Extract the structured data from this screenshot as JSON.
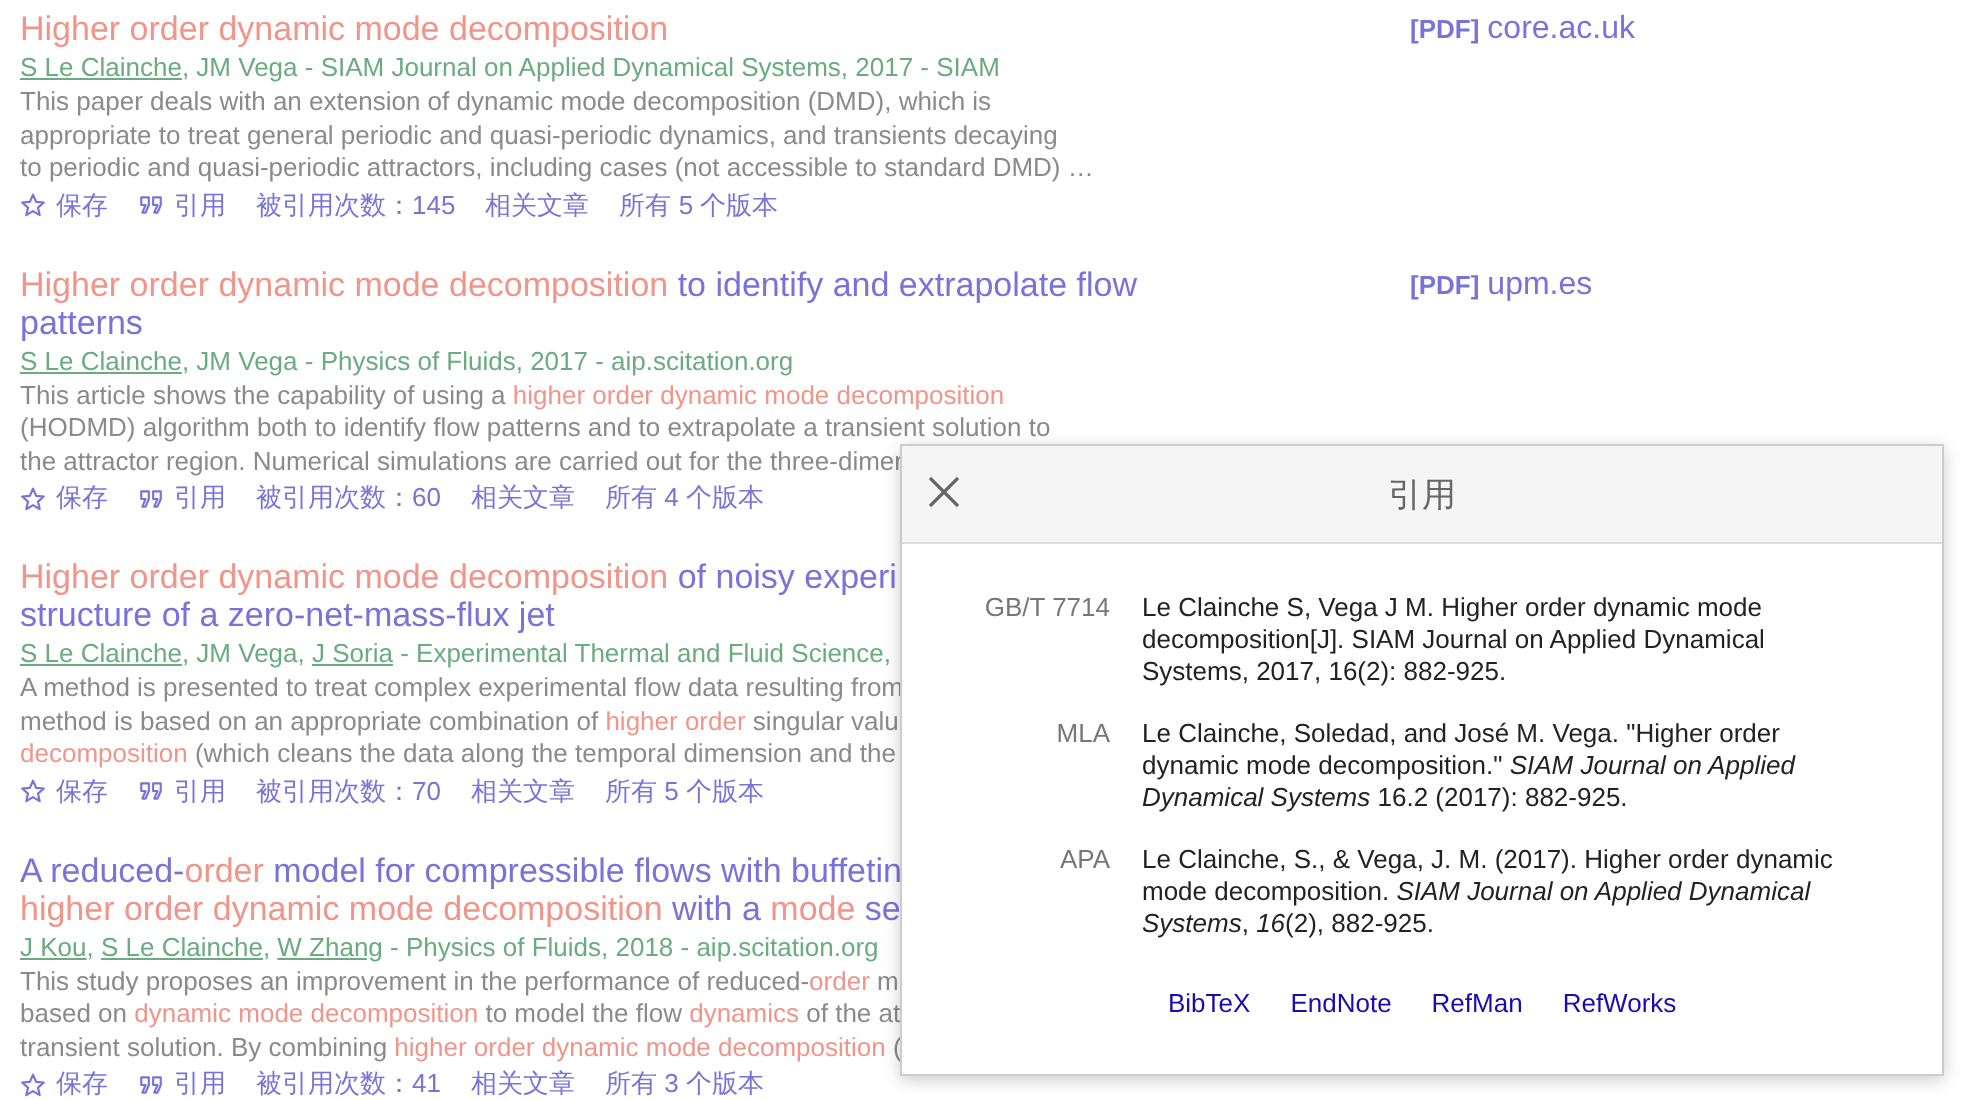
{
  "results": [
    {
      "title": [
        [
          {
            "text": "Higher order dynamic mode decomposition",
            "hl": true
          }
        ]
      ],
      "authors": [
        {
          "text": "S Le Clainche",
          "link": true
        },
        {
          "text": ", JM Vega - SIAM Journal on Applied Dynamical Systems, 2017 - SIAM",
          "link": false
        }
      ],
      "snippet": [
        [
          {
            "text": "This paper deals with an extension of dynamic mode decomposition (DMD), which is",
            "hl": false
          }
        ],
        [
          {
            "text": "appropriate to treat general periodic and quasi-periodic dynamics, and transients decaying",
            "hl": false
          }
        ],
        [
          {
            "text": "to periodic and quasi-periodic attractors, including cases (not accessible to standard DMD) …",
            "hl": false
          }
        ]
      ],
      "actions": [
        {
          "kind": "save",
          "label": "保存"
        },
        {
          "kind": "cite",
          "label": "引用"
        },
        {
          "kind": "text",
          "label": "被引用次数：145"
        },
        {
          "kind": "text",
          "label": "相关文章"
        },
        {
          "kind": "text",
          "label": "所有 5 个版本"
        }
      ],
      "source": {
        "tag": "[PDF]",
        "domain": "core.ac.uk"
      }
    },
    {
      "title": [
        [
          {
            "text": "Higher order dynamic mode decomposition",
            "hl": true
          },
          {
            "text": " to identify and extrapolate flow",
            "hl": false
          }
        ],
        [
          {
            "text": "patterns",
            "hl": false
          }
        ]
      ],
      "authors": [
        {
          "text": "S Le Clainche",
          "link": true
        },
        {
          "text": ", JM Vega - Physics of Fluids, 2017 - aip.scitation.org",
          "link": false
        }
      ],
      "snippet": [
        [
          {
            "text": "This article shows the capability of using a ",
            "hl": false
          },
          {
            "text": "higher order dynamic mode decomposition",
            "hl": true
          }
        ],
        [
          {
            "text": "(HODMD) algorithm both to identify flow patterns and to extrapolate a transient solution to",
            "hl": false
          }
        ],
        [
          {
            "text": "the attractor region. Numerical simulations are carried out for the three-dimer",
            "hl": false
          }
        ]
      ],
      "actions": [
        {
          "kind": "save",
          "label": "保存"
        },
        {
          "kind": "cite",
          "label": "引用"
        },
        {
          "kind": "text",
          "label": "被引用次数：60"
        },
        {
          "kind": "text",
          "label": "相关文章"
        },
        {
          "kind": "text",
          "label": "所有 4 个版本"
        }
      ],
      "source": {
        "tag": "[PDF]",
        "domain": "upm.es"
      }
    },
    {
      "title": [
        [
          {
            "text": "Higher order dynamic mode decomposition",
            "hl": true
          },
          {
            "text": " of noisy experi",
            "hl": false
          }
        ],
        [
          {
            "text": "structure of a zero-net-mass-flux jet",
            "hl": false
          }
        ]
      ],
      "authors": [
        {
          "text": "S Le Clainche",
          "link": true
        },
        {
          "text": ", JM Vega, ",
          "link": false
        },
        {
          "text": "J Soria",
          "link": true
        },
        {
          "text": " - Experimental Thermal and Fluid Science,",
          "link": false
        }
      ],
      "snippet": [
        [
          {
            "text": "A method is presented to treat complex experimental flow data resulting from",
            "hl": false
          }
        ],
        [
          {
            "text": "method is based on an appropriate combination of ",
            "hl": false
          },
          {
            "text": "higher order",
            "hl": true
          },
          {
            "text": " singular valu",
            "hl": false
          }
        ],
        [
          {
            "text": "decomposition",
            "hl": true
          },
          {
            "text": " (which cleans the data along the temporal dimension and the",
            "hl": false
          }
        ]
      ],
      "actions": [
        {
          "kind": "save",
          "label": "保存"
        },
        {
          "kind": "cite",
          "label": "引用"
        },
        {
          "kind": "text",
          "label": "被引用次数：70"
        },
        {
          "kind": "text",
          "label": "相关文章"
        },
        {
          "kind": "text",
          "label": "所有 5 个版本"
        }
      ]
    },
    {
      "title": [
        [
          {
            "text": "A reduced-",
            "hl": false
          },
          {
            "text": "order",
            "hl": true
          },
          {
            "text": " model for compressible flows with buffetin",
            "hl": false
          }
        ],
        [
          {
            "text": "higher order dynamic mode decomposition",
            "hl": true
          },
          {
            "text": " with a ",
            "hl": false
          },
          {
            "text": "mode",
            "hl": true
          },
          {
            "text": " se",
            "hl": false
          }
        ]
      ],
      "authors": [
        {
          "text": "J Kou",
          "link": true
        },
        {
          "text": ", ",
          "link": false
        },
        {
          "text": "S Le Clainche",
          "link": true
        },
        {
          "text": ", ",
          "link": false
        },
        {
          "text": "W Zhang",
          "link": true
        },
        {
          "text": " - Physics of Fluids, 2018 - aip.scitation.org",
          "link": false
        }
      ],
      "snippet": [
        [
          {
            "text": "This study proposes an improvement in the performance of reduced-",
            "hl": false
          },
          {
            "text": "order",
            "hl": true
          },
          {
            "text": " m",
            "hl": false
          }
        ],
        [
          {
            "text": "based on ",
            "hl": false
          },
          {
            "text": "dynamic mode decomposition",
            "hl": true
          },
          {
            "text": " to model the flow ",
            "hl": false
          },
          {
            "text": "dynamics",
            "hl": true
          },
          {
            "text": " of the at",
            "hl": false
          }
        ],
        [
          {
            "text": "transient solution. By combining ",
            "hl": false
          },
          {
            "text": "higher order dynamic mode decomposition",
            "hl": true
          },
          {
            "text": " (",
            "hl": false
          }
        ]
      ],
      "actions": [
        {
          "kind": "save",
          "label": "保存"
        },
        {
          "kind": "cite",
          "label": "引用"
        },
        {
          "kind": "text",
          "label": "被引用次数：41"
        },
        {
          "kind": "text",
          "label": "相关文章"
        },
        {
          "kind": "text",
          "label": "所有 3 个版本"
        }
      ]
    }
  ],
  "dialog": {
    "title": "引用",
    "citations": [
      {
        "style": "GB/T 7714",
        "text": "Le Clainche S, Vega J M. Higher order dynamic mode decomposition[J]. SIAM Journal on Applied Dynamical Systems, 2017, 16(2): 882-925."
      },
      {
        "style": "MLA",
        "text": "Le Clainche, Soledad, and José M. Vega. \"Higher order dynamic mode decomposition.\" *SIAM Journal on Applied Dynamical Systems* 16.2 (2017): 882-925."
      },
      {
        "style": "APA",
        "text": "Le Clainche, S., & Vega, J. M. (2017). Higher order dynamic mode decomposition. *SIAM Journal on Applied Dynamical Systems*, *16*(2), 882-925."
      }
    ],
    "exports": [
      "BibTeX",
      "EndNote",
      "RefMan",
      "RefWorks"
    ]
  }
}
